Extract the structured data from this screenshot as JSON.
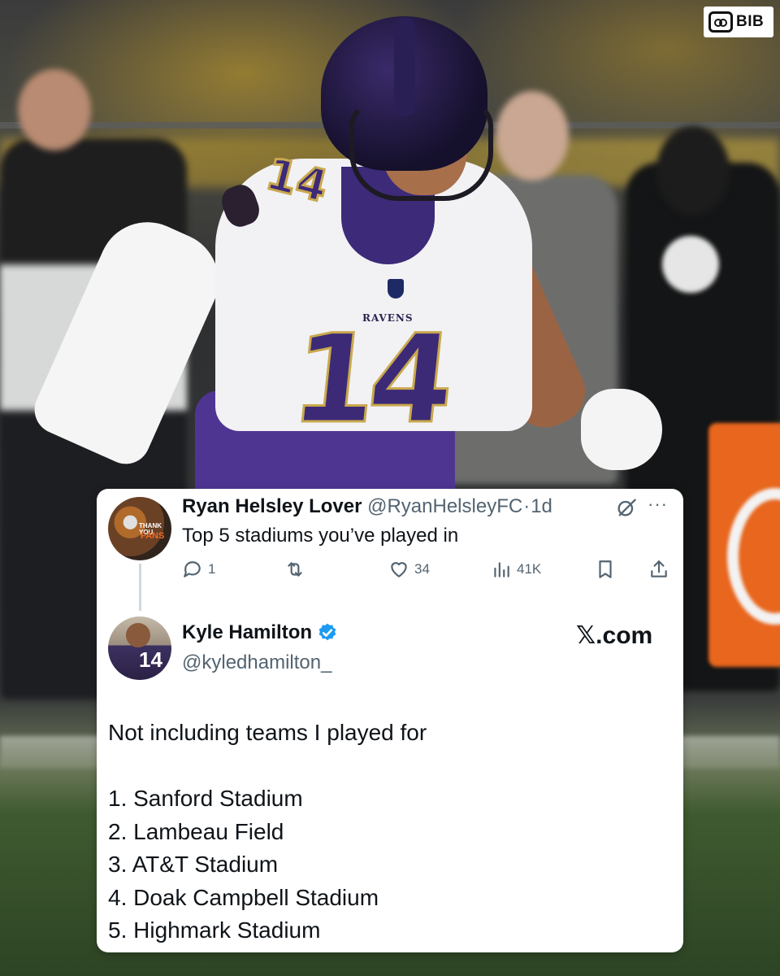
{
  "watermark": {
    "brand_text": "BIB"
  },
  "photo": {
    "jersey_number": "14",
    "jersey_wordmark": "RAVENS"
  },
  "colors": {
    "x_text_primary": "#0f1419",
    "x_text_secondary": "#536471",
    "x_verified_blue": "#1d9bf0",
    "ravens_purple": "#4f3592",
    "card_background": "#ffffff"
  },
  "reply": {
    "avatar": {
      "icon": "profile-avatar",
      "overlay_line1": "THANK YOU",
      "overlay_line2": "FANS"
    },
    "display_name": "Ryan Helsley Lover",
    "handle": "@RyanHelsleyFC",
    "separator": "·",
    "time": "1d",
    "text": "Top 5 stadiums you’ve played in",
    "icons": {
      "grok": "grok-icon",
      "more": "more-icon"
    },
    "actions": {
      "reply_count": "1",
      "retweet_count": "",
      "like_count": "34",
      "views_count": "41K"
    }
  },
  "tweet": {
    "avatar": {
      "icon": "profile-avatar",
      "overlay_text": "14"
    },
    "display_name": "Kyle Hamilton",
    "verified": true,
    "handle": "@kyledhamilton_",
    "source_badge_glyph": "𝕏",
    "source_badge_text": ".com",
    "body": [
      "Not including teams I played for",
      "",
      "1. Sanford Stadium",
      "2. Lambeau Field",
      "3. AT&T Stadium",
      "4. Doak Campbell Stadium",
      "5. Highmark Stadium"
    ]
  }
}
